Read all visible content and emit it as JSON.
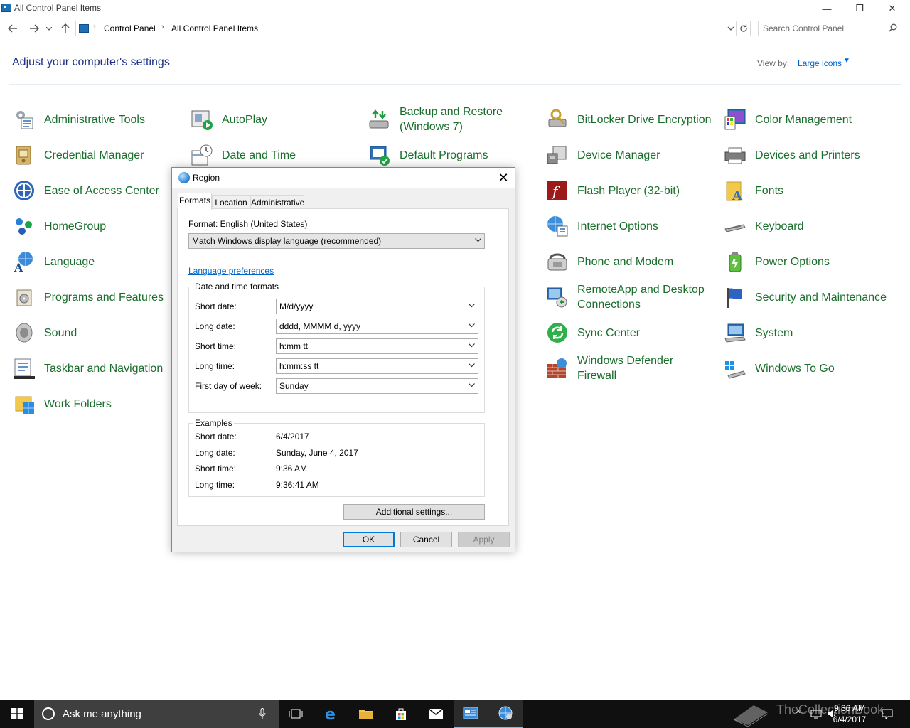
{
  "window": {
    "title": "All Control Panel Items",
    "minimize": "—",
    "restore": "❐",
    "close": "✕"
  },
  "address": {
    "crumbs": [
      "Control Panel",
      "All Control Panel Items"
    ],
    "search_placeholder": "Search Control Panel"
  },
  "header": {
    "title": "Adjust your computer's settings",
    "view_by_label": "View by:",
    "view_by_value": "Large icons"
  },
  "items": {
    "administrative_tools": "Administrative Tools",
    "autoplay": "AutoPlay",
    "backup_restore_l1": "Backup and Restore",
    "backup_restore_l2": "(Windows 7)",
    "bitlocker": "BitLocker Drive Encryption",
    "color_management": "Color Management",
    "credential_manager": "Credential Manager",
    "date_time": "Date and Time",
    "default_programs": "Default Programs",
    "device_manager": "Device Manager",
    "devices_printers": "Devices and Printers",
    "ease_of_access": "Ease of Access Center",
    "flash_player": "Flash Player (32-bit)",
    "fonts": "Fonts",
    "homegroup": "HomeGroup",
    "internet_options": "Internet Options",
    "keyboard": "Keyboard",
    "language": "Language",
    "phone_modem": "Phone and Modem",
    "power_options": "Power Options",
    "programs_features": "Programs and Features",
    "remoteapp_l1": "RemoteApp and Desktop",
    "remoteapp_l2": "Connections",
    "security_maintenance": "Security and Maintenance",
    "sound": "Sound",
    "sync_center": "Sync Center",
    "system": "System",
    "taskbar_navigation": "Taskbar and Navigation",
    "defender_l1": "Windows Defender",
    "defender_l2": "Firewall",
    "windows_to_go": "Windows To Go",
    "work_folders": "Work Folders"
  },
  "dialog": {
    "title": "Region",
    "close": "✕",
    "tabs": [
      "Formats",
      "Location",
      "Administrative"
    ],
    "format_label": "Format: English (United States)",
    "format_value": "Match Windows display language (recommended)",
    "language_link": "Language preferences",
    "dt_group_title": "Date and time formats",
    "dt_rows": [
      {
        "label": "Short date:",
        "value": "M/d/yyyy"
      },
      {
        "label": "Long date:",
        "value": "dddd, MMMM d, yyyy"
      },
      {
        "label": "Short time:",
        "value": "h:mm tt"
      },
      {
        "label": "Long time:",
        "value": "h:mm:ss tt"
      },
      {
        "label": "First day of week:",
        "value": "Sunday"
      }
    ],
    "examples_title": "Examples",
    "examples": [
      {
        "label": "Short date:",
        "value": "6/4/2017"
      },
      {
        "label": "Long date:",
        "value": "Sunday, June 4, 2017"
      },
      {
        "label": "Short time:",
        "value": "9:36 AM"
      },
      {
        "label": "Long time:",
        "value": "9:36:41 AM"
      }
    ],
    "additional_settings": "Additional settings...",
    "ok": "OK",
    "cancel": "Cancel",
    "apply": "Apply"
  },
  "taskbar": {
    "search_text": "Ask me anything",
    "time": "9:36 AM",
    "date": "6/4/2017",
    "watermark": "TheCollectionBook"
  }
}
